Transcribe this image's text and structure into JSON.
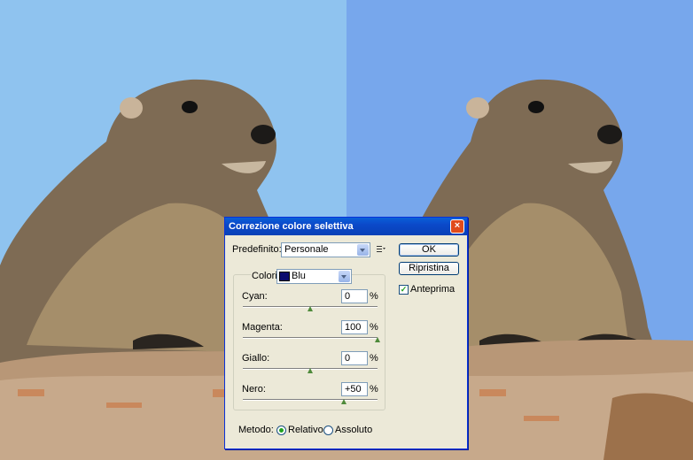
{
  "dialog": {
    "title": "Correzione colore selettiva",
    "close_glyph": "×",
    "preset": {
      "label": "Predefinito:",
      "value": "Personale"
    },
    "colors": {
      "label": "Colori:",
      "value": "Blu",
      "swatch_color": "#0a0a6e"
    },
    "sliders": [
      {
        "label": "Cyan:",
        "value": "0",
        "unit": "%",
        "percent": 0
      },
      {
        "label": "Magenta:",
        "value": "100",
        "unit": "%",
        "percent": 100
      },
      {
        "label": "Giallo:",
        "value": "0",
        "unit": "%",
        "percent": 0
      },
      {
        "label": "Nero:",
        "value": "+50",
        "unit": "%",
        "percent": 50
      }
    ],
    "buttons": {
      "ok": "OK",
      "reset": "Ripristina"
    },
    "preview": {
      "label": "Anteprima",
      "checked": true,
      "check_glyph": "✓"
    },
    "method": {
      "label": "Metodo:",
      "options": [
        {
          "label": "Relativo",
          "selected": true
        },
        {
          "label": "Assoluto",
          "selected": false
        }
      ]
    }
  },
  "colors": {
    "titlebar": "#0b49c9",
    "dialog_bg": "#ece9d8",
    "sky_before": "#8fc3ef",
    "sky_after": "#77a7ec",
    "check_green": "#21a121"
  },
  "icons": [
    "close-icon",
    "dropdown-arrow-icon",
    "preset-menu-icon",
    "color-swatch",
    "checkmark-icon"
  ]
}
